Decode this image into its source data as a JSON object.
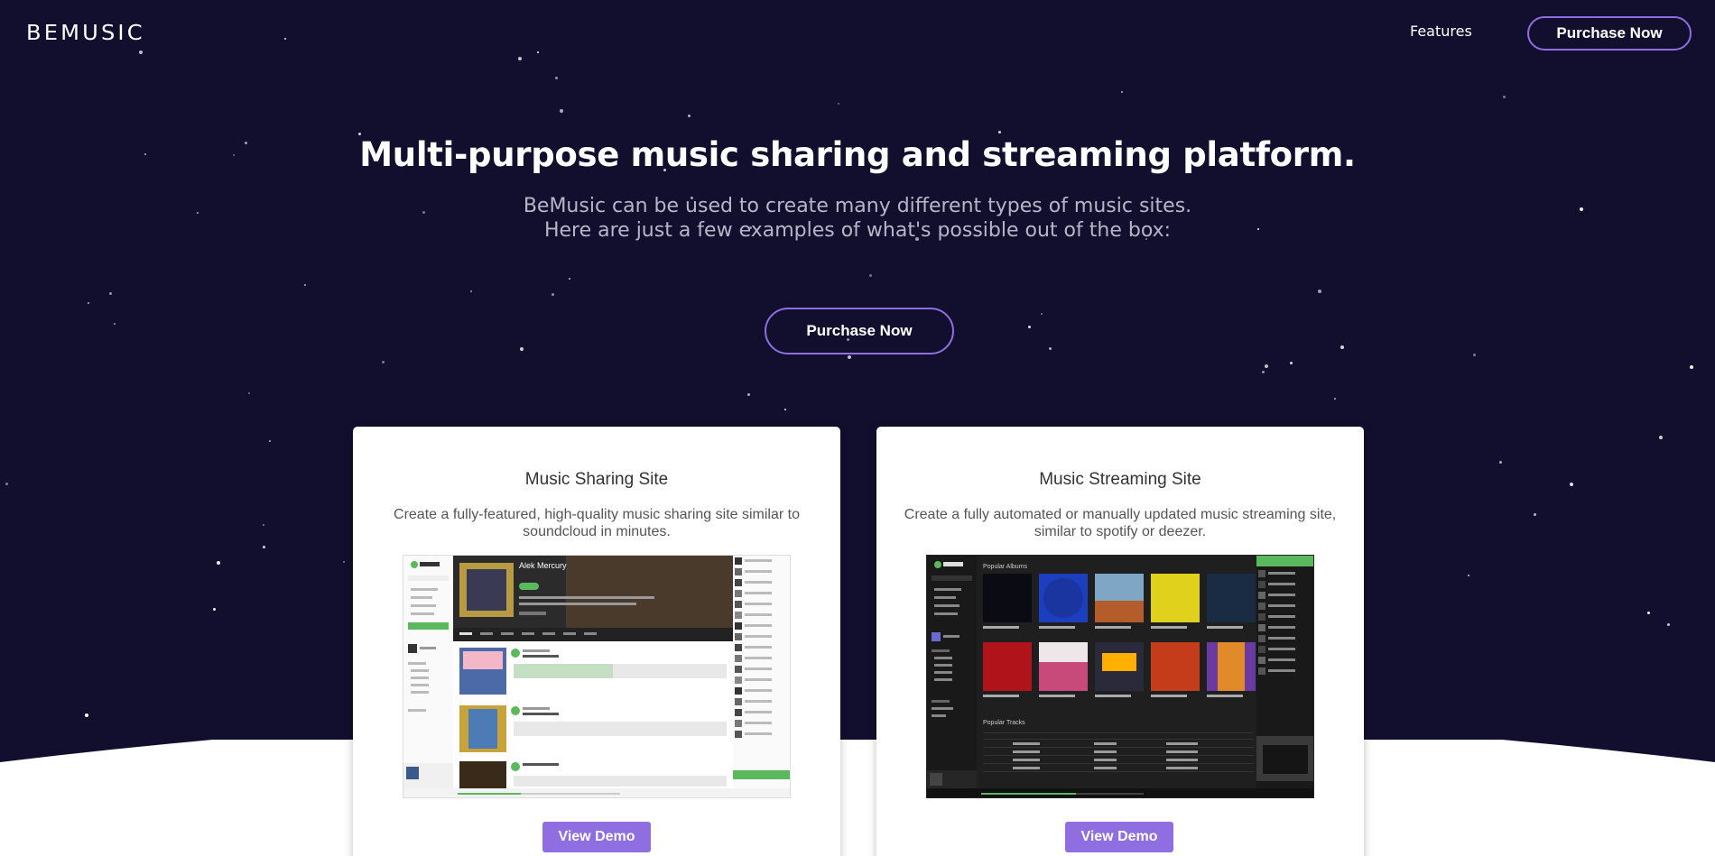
{
  "header": {
    "logo": "BEMUSIC",
    "nav_features": "Features",
    "purchase_label": "Purchase Now"
  },
  "hero": {
    "title": "Multi-purpose music sharing and streaming platform.",
    "subtitle_line1": "BeMusic can be used to create many different types of music sites.",
    "subtitle_line2": "Here are just a few examples of what's possible out of the box:",
    "purchase_label": "Purchase Now"
  },
  "cards": [
    {
      "title": "Music Sharing Site",
      "description": "Create a fully-featured, high-quality music sharing site similar to soundcloud in minutes.",
      "demo_label": "View Demo",
      "screenshot": {
        "artist": "Alek Mercury"
      }
    },
    {
      "title": "Music Streaming Site",
      "description": "Create a fully automated or manually updated music streaming site, similar to spotify or deezer.",
      "demo_label": "View Demo",
      "screenshot": {
        "section_albums": "Popular Albums",
        "section_tracks": "Popular Tracks"
      }
    }
  ],
  "colors": {
    "background": "#120f2e",
    "accent": "#8e6ee0",
    "card": "#ffffff",
    "brand_green": "#5cb85c"
  }
}
